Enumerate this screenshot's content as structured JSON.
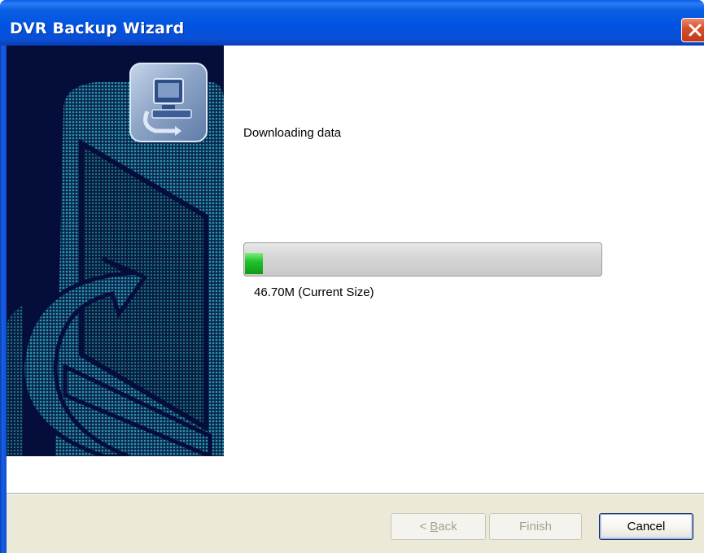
{
  "window": {
    "title": "DVR Backup Wizard"
  },
  "content": {
    "status_text": "Downloading data",
    "progress_fraction": 0.05,
    "size_text": "46.70M (Current Size)"
  },
  "buttons": {
    "back_prefix": "< ",
    "back_mnemonic": "B",
    "back_rest": "ack",
    "finish_label": "Finish",
    "cancel_label": "Cancel"
  },
  "icons": {
    "close": "close-icon",
    "banner_graphic": "backup-arrow-illustration",
    "banner_badge": "computer-backup-icon"
  },
  "colors": {
    "titlebar": "#0054e3",
    "banner_bg": "#050e3a",
    "banner_art": "#1f8a9a",
    "progress_fill": "#22c22c",
    "footer_bg": "#ece9d8"
  }
}
